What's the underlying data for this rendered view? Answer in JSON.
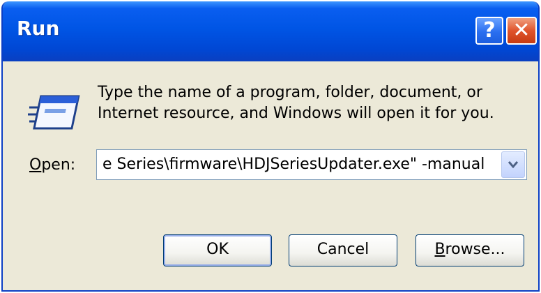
{
  "window": {
    "title": "Run",
    "help_button": "?",
    "close_button": "✕"
  },
  "dialog": {
    "description_line1": "Type the name of a program, folder, document, or",
    "description_line2": "Internet resource, and Windows will open it for you.",
    "open_label_accel": "O",
    "open_label_rest": "pen:",
    "open_value": "e Series\\firmware\\HDJSeriesUpdater.exe\" -manual",
    "icon": "run-program-icon"
  },
  "buttons": {
    "ok": "OK",
    "cancel": "Cancel",
    "browse_accel": "B",
    "browse_rest": "rowse..."
  },
  "colors": {
    "titlebar": "#0055e5",
    "body": "#ece9d8",
    "close": "#e0542c"
  }
}
